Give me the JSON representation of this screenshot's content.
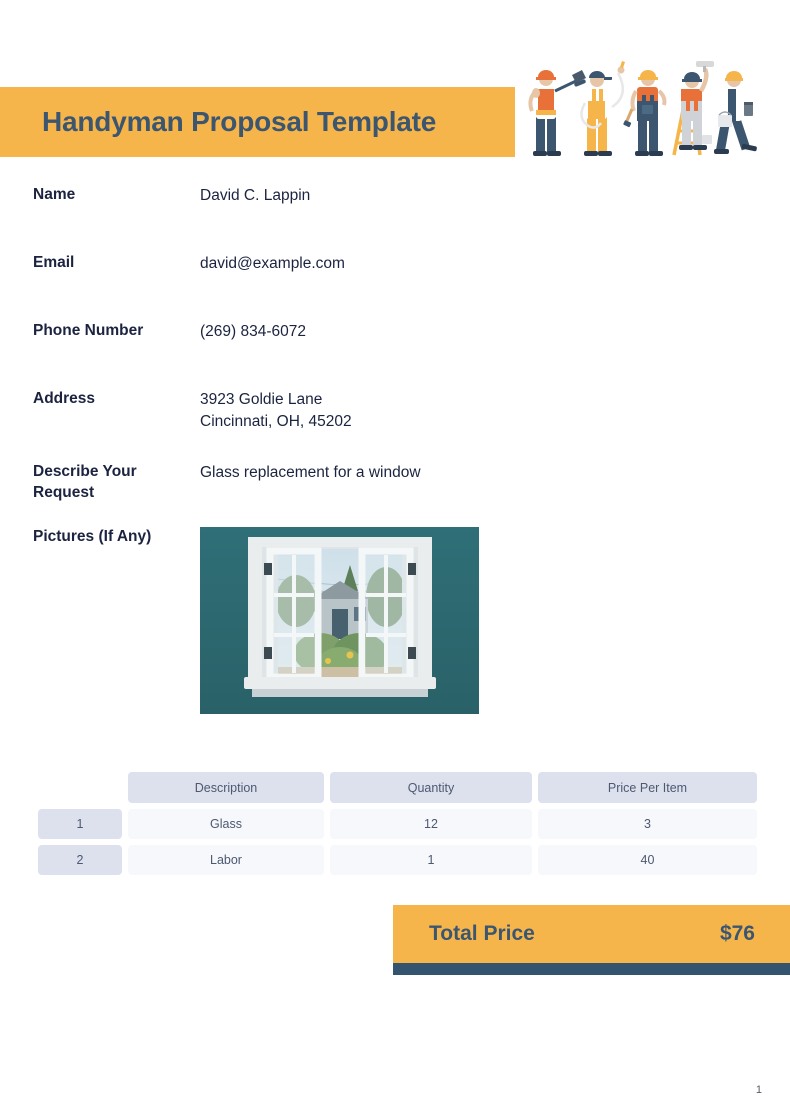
{
  "document": {
    "title": "Handyman Proposal Template",
    "page_number": "1"
  },
  "illustration": {
    "name": "handyman-workers-illustration",
    "workers": [
      {
        "role": "worker-with-shovel",
        "helmet": "#e8713a",
        "shirt": "#ffffff",
        "vest": "#e8713a",
        "pants": "#3d5670"
      },
      {
        "role": "worker-with-hose",
        "helmet": "#3d5670",
        "shirt": "#ffffff",
        "overalls": "#f6b54b",
        "pants": "#f6b54b"
      },
      {
        "role": "worker-with-hammer",
        "helmet": "#f6b54b",
        "shirt": "#e8713a",
        "overalls": "#3d5670",
        "pants": "#3d5670"
      },
      {
        "role": "worker-on-ladder-with-roller",
        "helmet": "#3d5670",
        "shirt": "#e8713a",
        "overalls": "#cfd3d8",
        "ladder": "#f6b54b"
      },
      {
        "role": "worker-with-paint-can",
        "helmet": "#f6b54b",
        "shirt": "#ffffff",
        "pants": "#3d5670"
      }
    ]
  },
  "form": {
    "fields": [
      {
        "label": "Name",
        "value": "David C. Lappin"
      },
      {
        "label": "Email",
        "value": "david@example.com"
      },
      {
        "label": "Phone Number",
        "value": "(269) 834-6072"
      },
      {
        "label": "Address",
        "value": "3923 Goldie Lane\nCincinnati, OH, 45202"
      },
      {
        "label": "Describe Your Request",
        "value": "Glass replacement for a window"
      },
      {
        "label": "Pictures (If Any)",
        "value": ""
      }
    ],
    "picture": {
      "alt": "open white casement window against a teal wall looking out onto a garden",
      "wall_color": "#2e6b72",
      "frame_color": "#eef1f2"
    }
  },
  "items_table": {
    "headers": [
      "",
      "Description",
      "Quantity",
      "Price Per Item"
    ],
    "rows": [
      {
        "num": "1",
        "description": "Glass",
        "quantity": "12",
        "price": "3"
      },
      {
        "num": "2",
        "description": "Labor",
        "quantity": "1",
        "price": "40"
      }
    ]
  },
  "total": {
    "label": "Total Price",
    "value": "$76"
  },
  "colors": {
    "accent_orange": "#f6b54b",
    "dark_blue": "#33536f",
    "text_navy": "#1b2340",
    "header_cell": "#dde1ed",
    "data_cell": "#f6f8fb"
  }
}
